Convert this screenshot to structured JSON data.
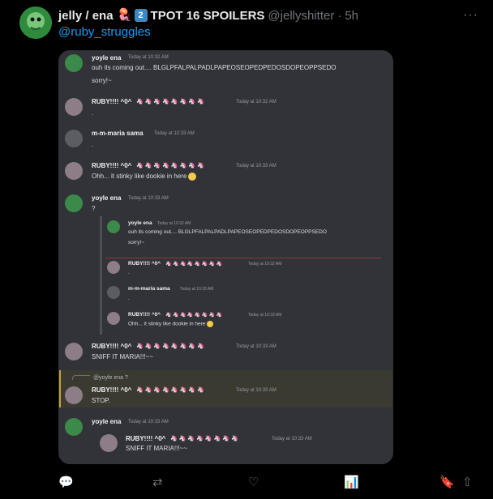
{
  "tweet": {
    "display_name": "jelly / ena",
    "display_name_2": "TPOT 16 SPOILERS",
    "emoji_1": "🪼",
    "emoji_2": "2",
    "handle": "@jellyshitter",
    "dot": "·",
    "time": "5h",
    "more": "···",
    "mention": "@ruby_struggles"
  },
  "discord": {
    "messages": [
      {
        "user": "yoyle ena",
        "time": "Today at 10:32 AM",
        "lines": [
          "ouh its coming out.... BLGLPFALPALPADLPAPEOSEOPEDPEDOSDOPEOPPSEDO",
          "sorry!~"
        ]
      },
      {
        "user": "RUBY!!!! ^0^",
        "time": "Today at 10:32 AM",
        "lines": [
          "."
        ]
      },
      {
        "user": "m-m-maria sama",
        "time": "Today at 10:33 AM",
        "lines": [
          "."
        ]
      },
      {
        "user": "RUBY!!!! ^0^",
        "time": "Today at 10:33 AM",
        "lines": [
          "Ohh... it stinky like dookie in here"
        ]
      },
      {
        "user": "yoyle ena",
        "time": "Today at 10:33 AM",
        "lines": [
          "?"
        ]
      },
      {
        "user": "RUBY!!!! ^0^",
        "time": "Today at 10:33 AM",
        "lines": [
          "SNIFF IT MARIA!!!~~"
        ]
      },
      {
        "user": "RUBY!!!! ^0^",
        "time": "Today at 10:33 AM",
        "lines": [
          "STOP."
        ]
      },
      {
        "user": "yoyle ena",
        "time": "Today at 10:33 AM",
        "lines": []
      }
    ],
    "quoted": [
      {
        "user": "yoyle ena",
        "time": "Today at 10:32 AM",
        "lines": [
          "ouh its coming out.... BLGLPFALPALPADLPAPEOSEOPEDPEDOSDOPEOPPSEDO",
          "sorry!~"
        ]
      },
      {
        "user": "RUBY!!!! ^0^",
        "time": "Today at 10:32 AM",
        "lines": [
          "."
        ]
      },
      {
        "user": "m-m-maria sama",
        "time": "Today at 10:33 AM",
        "lines": [
          "."
        ]
      },
      {
        "user": "RUBY!!!! ^0^",
        "time": "Today at 10:33 AM",
        "lines": [
          "Ohh... it stinky like dookie in here"
        ]
      }
    ],
    "nested": {
      "user": "RUBY!!!! ^0^",
      "time": "Today at 10:33 AM",
      "text": "SNIFF IT MARIA!!!~~"
    },
    "reply_ref": "@yoyle ena",
    "reply_icon": "?",
    "unicorns": "🦄🦄🦄🦄🦄🦄🦄🦄"
  },
  "actions": {
    "reply_icon": "💬",
    "retweet_icon": "⇄",
    "like_icon": "♡",
    "views_icon": "📊",
    "bookmark_icon": "🔖",
    "share_icon": "⇧"
  },
  "colors": {
    "accent": "#1d9bf0",
    "discord_bg": "#313338",
    "highlight": "#3b3a30"
  }
}
